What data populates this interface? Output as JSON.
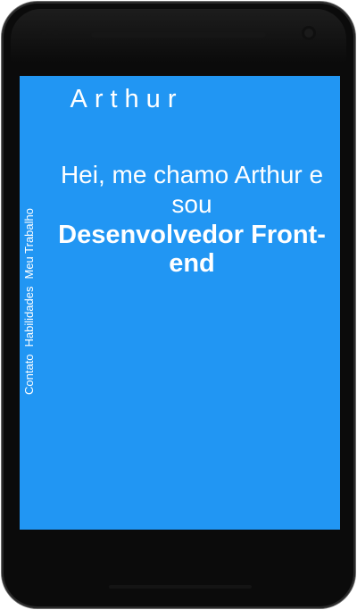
{
  "header": {
    "brand": "Arthur"
  },
  "nav": {
    "items": [
      {
        "label": "Contato"
      },
      {
        "label": "Habilidades"
      },
      {
        "label": "Meu Trabalho"
      }
    ]
  },
  "hero": {
    "greeting": "Hei, me chamo Arthur e sou",
    "role": "Desenvolvedor Front-end"
  },
  "colors": {
    "screen_background": "#2196f3",
    "text": "#ffffff",
    "device_frame": "#0b0b0b"
  }
}
